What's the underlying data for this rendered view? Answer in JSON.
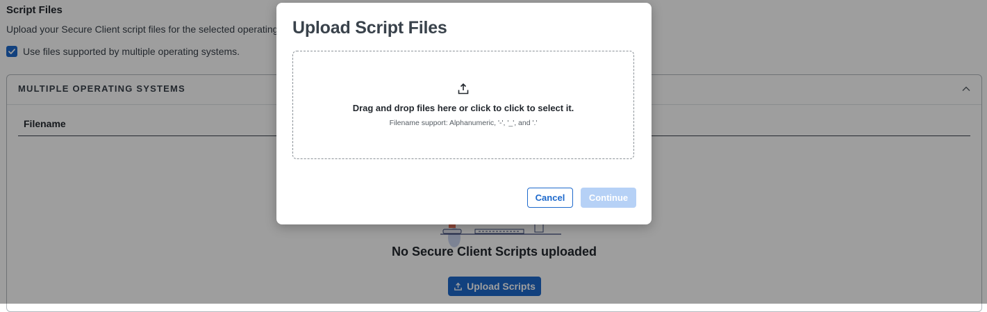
{
  "page": {
    "section_title": "Script Files",
    "section_description": "Upload your Secure Client script files for the selected operating",
    "checkbox_label": "Use files supported by multiple operating systems.",
    "checkbox_checked": true
  },
  "panel": {
    "title": "MULTIPLE OPERATING SYSTEMS",
    "column_header": "Filename",
    "empty_title": "No Secure Client Scripts uploaded",
    "upload_button_label": "Upload Scripts"
  },
  "modal": {
    "title": "Upload Script Files",
    "dropzone_text": "Drag and drop files here or click to click to select it.",
    "dropzone_subtext": "Filename support: Alphanumeric, '-', '_', and '.'",
    "cancel_label": "Cancel",
    "continue_label": "Continue",
    "continue_disabled": true
  },
  "colors": {
    "accent": "#1d69cc",
    "disabled_button": "#b6d1f6",
    "overlay": "rgba(0,0,0,0.38)"
  },
  "icons": [
    "check-icon",
    "chevron-up-icon",
    "upload-icon"
  ]
}
